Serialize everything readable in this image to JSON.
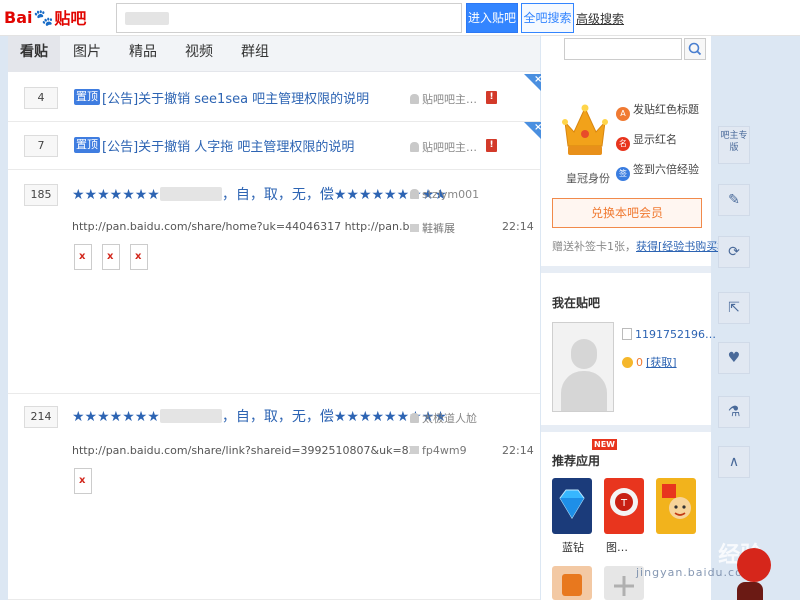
{
  "topbar": {
    "logo_bai": "Bai",
    "logo_tieba": "贴吧",
    "enter_button": "进入贴吧",
    "all_button": "全吧搜索",
    "advanced_link": "高级搜索"
  },
  "tabs": [
    {
      "label": "看贴",
      "active": true
    },
    {
      "label": "图片",
      "active": false
    },
    {
      "label": "精品",
      "active": false
    },
    {
      "label": "视频",
      "active": false
    },
    {
      "label": "群组",
      "active": false
    }
  ],
  "threads": [
    {
      "count": "4",
      "pin": "置顶",
      "title": "[公告]关于撤销 see1sea 吧主管理权限的说明",
      "author": "贴吧吧主…",
      "flag": "!",
      "close": "×"
    },
    {
      "count": "7",
      "pin": "置顶",
      "title": "[公告]关于撤销 人字拖 吧主管理权限的说明",
      "author": "贴吧吧主…",
      "flag": "!",
      "close": "×"
    },
    {
      "count": "185",
      "stars_pre": "★★★★★★★",
      "stars_post": "，自，取，无，偿★★★★★★★★★",
      "author": "stzlym001",
      "excerpt": "http://pan.baidu.com/share/home?uk=44046317 http://pan.baidu.com/share/home...",
      "replier": "鞋裤展",
      "time": "22:14",
      "thumb_mark": "x"
    },
    {
      "count": "214",
      "stars_pre": "★★★★★★★",
      "stars_post": "，自，取，无，偿★★★★★★★★★",
      "author": "太极道人尬",
      "excerpt": "http://pan.baidu.com/share/link?shareid=3992510807&uk=832723",
      "replier": "fp4wm9",
      "time": "22:14",
      "thumb_mark": "x"
    }
  ],
  "side": {
    "crown_label": "皇冠身份",
    "privileges": [
      "发贴红色标题",
      "显示红名",
      "签到六倍经验"
    ],
    "exchange_button": "兑换本吧会员",
    "gift_text": "赠送补签卡1张，",
    "gift_link": "获得[经验书购买权]",
    "my_tieba_title": "我在贴吧",
    "user_id": "1191752196…",
    "coins": "0",
    "coins_link": "[获取]",
    "apps_title": "推荐应用",
    "new_badge": "NEW",
    "app_labels": [
      "蓝钻",
      "图…"
    ]
  },
  "rightbar": {
    "owner_label": "吧主专版",
    "edit_icon": "✎",
    "refresh_icon": "⟳",
    "share_icon": "⇱",
    "heart_icon": "♥",
    "flask_icon": "⚗",
    "up_icon": "∧"
  },
  "watermark": {
    "main": "Baidu 经验",
    "sub": "jingyan.baidu.com"
  },
  "colors": {
    "link_blue": "#2d64b3",
    "primary_blue": "#3385ff",
    "orange": "#f07a32",
    "red": "#d33a2a",
    "page_bg": "#dce7f3"
  }
}
